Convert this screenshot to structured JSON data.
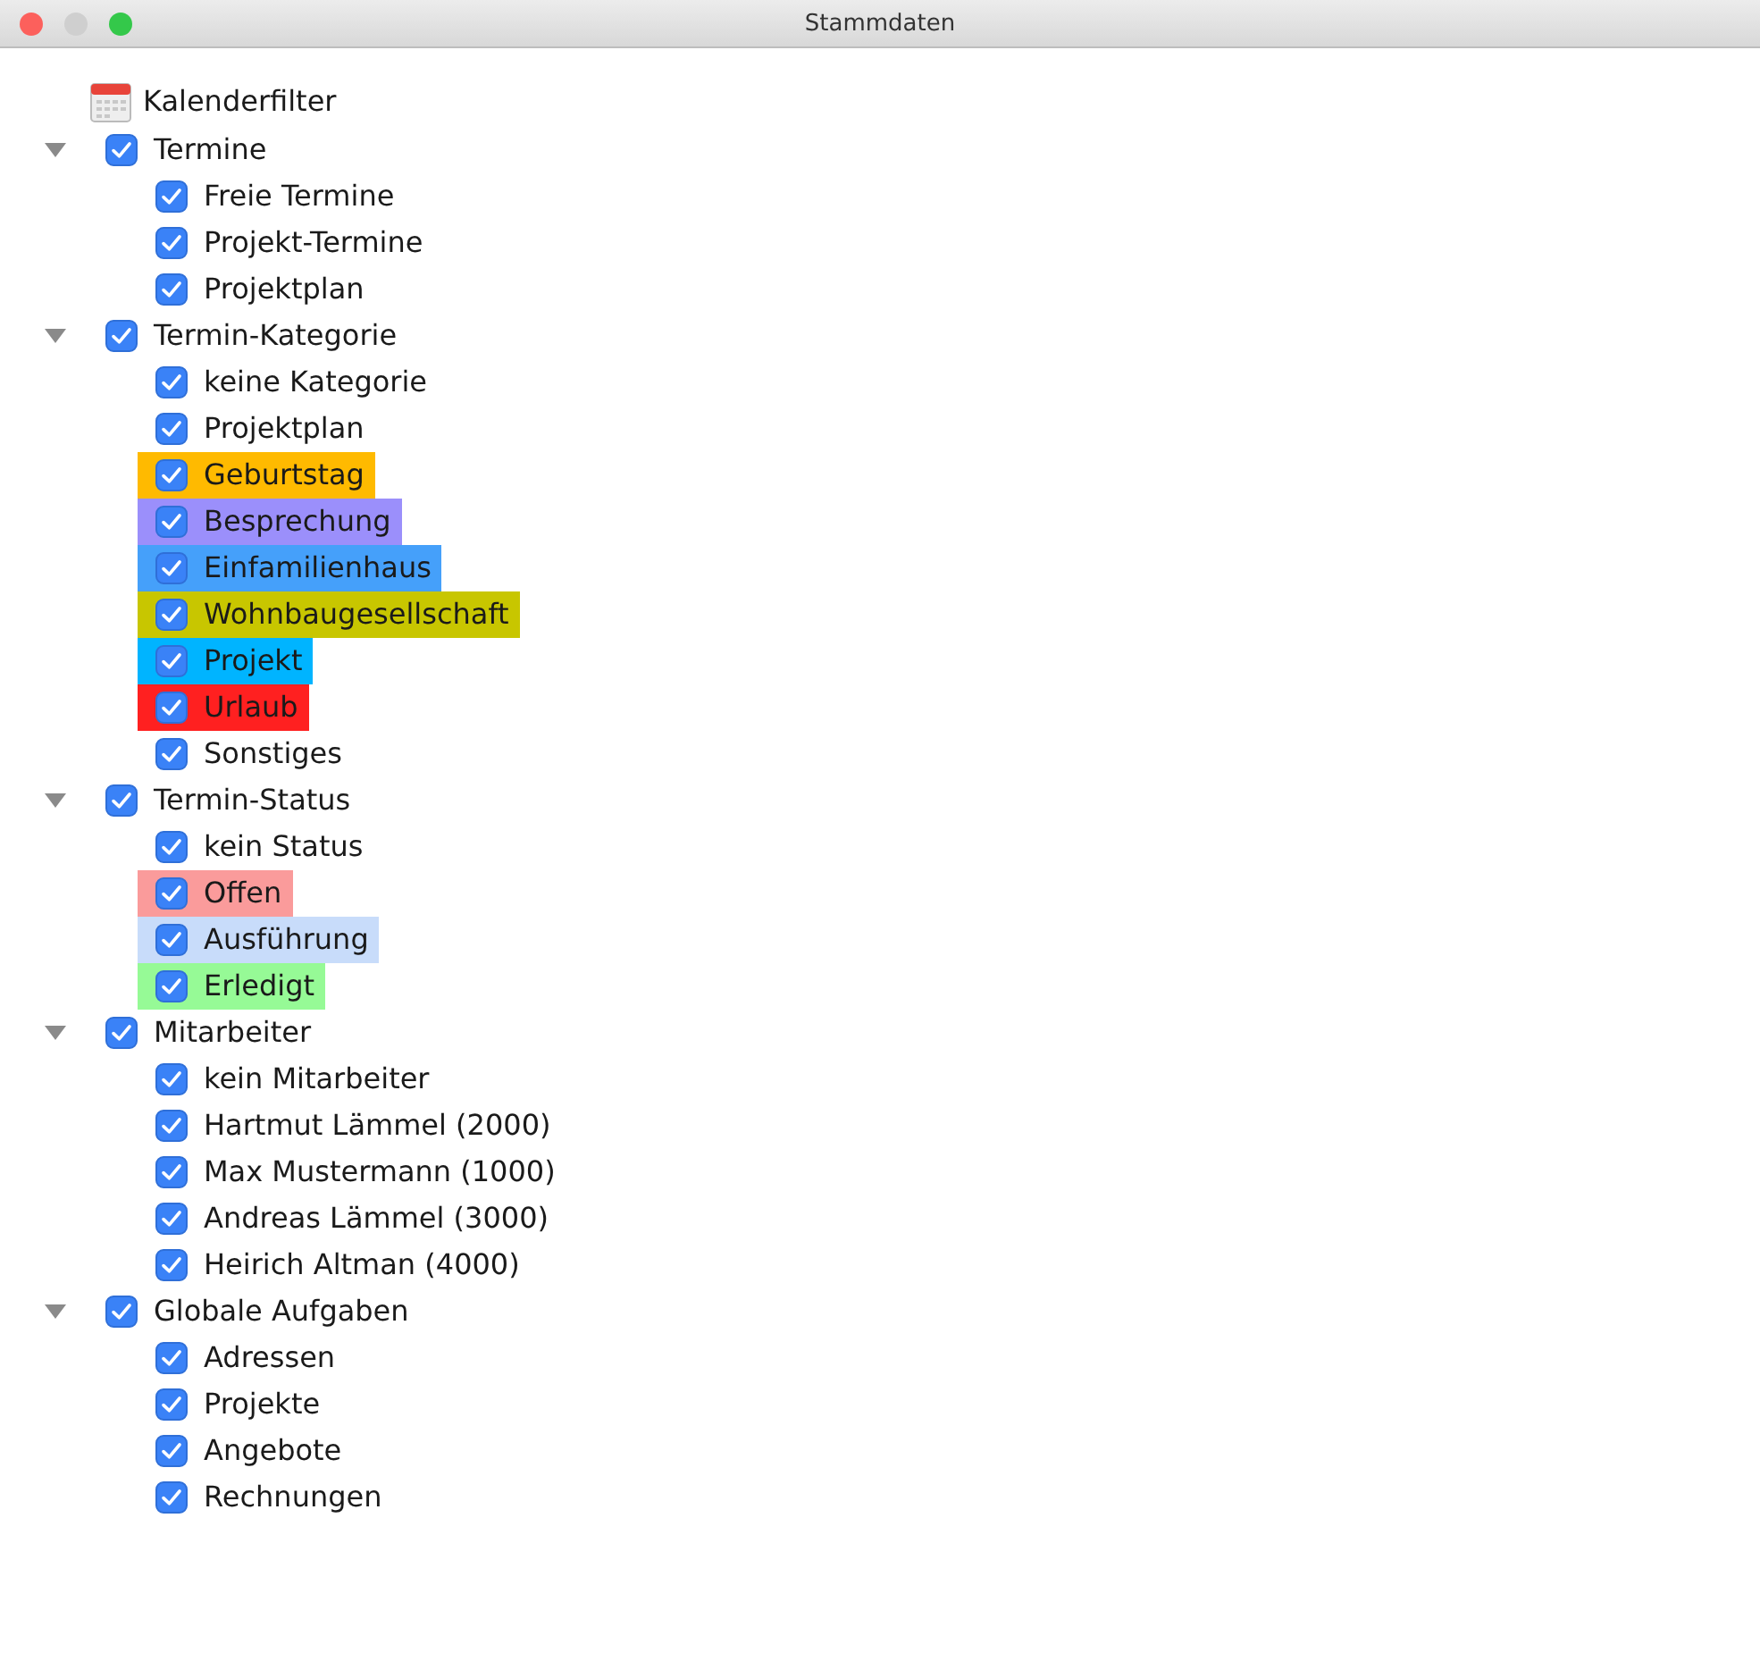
{
  "window": {
    "title": "Stammdaten"
  },
  "tree": {
    "label": "Kalenderfilter",
    "children": [
      {
        "label": "Termine",
        "expanded": true,
        "checked": true,
        "children": [
          {
            "label": "Freie Termine",
            "checked": true
          },
          {
            "label": "Projekt-Termine",
            "checked": true
          },
          {
            "label": "Projektplan",
            "checked": true
          }
        ]
      },
      {
        "label": "Termin-Kategorie",
        "expanded": true,
        "checked": true,
        "children": [
          {
            "label": "keine Kategorie",
            "checked": true
          },
          {
            "label": "Projektplan",
            "checked": true
          },
          {
            "label": "Geburtstag",
            "checked": true,
            "color": "#ffba00"
          },
          {
            "label": "Besprechung",
            "checked": true,
            "color": "#9b8ffb"
          },
          {
            "label": "Einfamilienhaus",
            "checked": true,
            "color": "#45a0fa"
          },
          {
            "label": "Wohnbaugesellschaft",
            "checked": true,
            "color": "#c8c600"
          },
          {
            "label": "Projekt",
            "checked": true,
            "color": "#00b4ff"
          },
          {
            "label": "Urlaub",
            "checked": true,
            "color": "#ff2020"
          },
          {
            "label": "Sonstiges",
            "checked": true
          }
        ]
      },
      {
        "label": "Termin-Status",
        "expanded": true,
        "checked": true,
        "children": [
          {
            "label": "kein Status",
            "checked": true
          },
          {
            "label": "Offen",
            "checked": true,
            "color": "#fa9b9b"
          },
          {
            "label": "Ausführung",
            "checked": true,
            "color": "#c8dcfa"
          },
          {
            "label": "Erledigt",
            "checked": true,
            "color": "#96fa96"
          }
        ]
      },
      {
        "label": "Mitarbeiter",
        "expanded": true,
        "checked": true,
        "children": [
          {
            "label": "kein Mitarbeiter",
            "checked": true
          },
          {
            "label": "Hartmut Lämmel (2000)",
            "checked": true
          },
          {
            "label": "Max Mustermann (1000)",
            "checked": true
          },
          {
            "label": "Andreas Lämmel (3000)",
            "checked": true
          },
          {
            "label": "Heirich Altman (4000)",
            "checked": true
          }
        ]
      },
      {
        "label": "Globale Aufgaben",
        "expanded": true,
        "checked": true,
        "children": [
          {
            "label": "Adressen",
            "checked": true
          },
          {
            "label": "Projekte",
            "checked": true
          },
          {
            "label": "Angebote",
            "checked": true
          },
          {
            "label": "Rechnungen",
            "checked": true
          }
        ]
      }
    ]
  }
}
